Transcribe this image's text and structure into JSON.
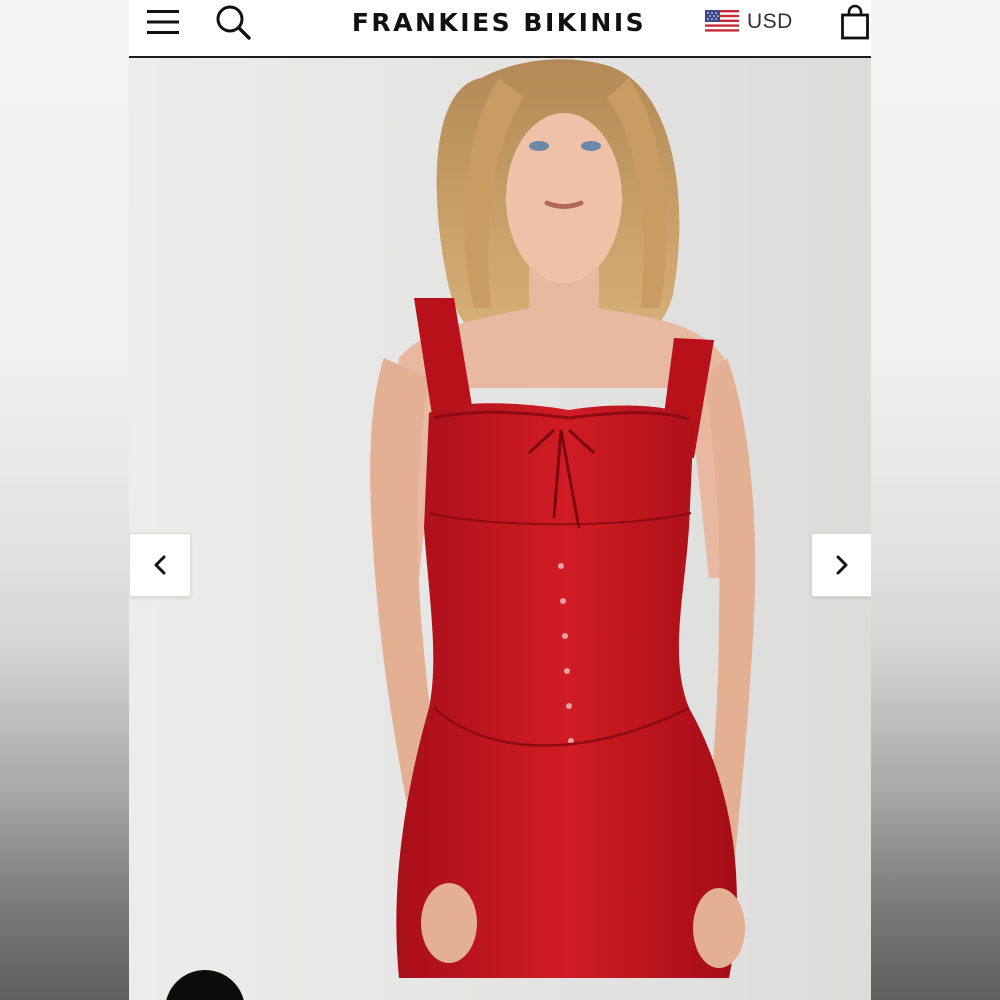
{
  "header": {
    "brand": "FRANKIES BIKINIS",
    "currency": "USD",
    "icons": {
      "menu": "hamburger-menu-icon",
      "search": "search-icon",
      "flag": "us-flag-icon",
      "bag": "shopping-bag-icon"
    }
  },
  "gallery": {
    "image_subject": "model wearing red corset mini dress",
    "prev_icon": "chevron-left-icon",
    "next_icon": "chevron-right-icon"
  },
  "colors": {
    "dress": "#c8141e",
    "header_bg": "#ffffff",
    "text": "#111111"
  }
}
